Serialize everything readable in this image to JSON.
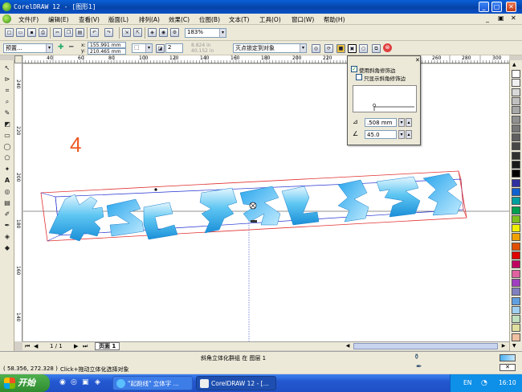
{
  "window": {
    "title": "CorelDRAW 12 - [图形1]"
  },
  "menu": {
    "items": [
      "文件(F)",
      "编辑(E)",
      "查看(V)",
      "版面(L)",
      "排列(A)",
      "效果(C)",
      "位图(B)",
      "文本(T)",
      "工具(O)",
      "窗口(W)",
      "帮助(H)"
    ]
  },
  "standard_toolbar": {
    "zoom": "183%"
  },
  "property_bar": {
    "preset": "预置...",
    "x": "155.991 mm",
    "y": "210.465 mm",
    "depth": "2",
    "vp_x": "8.824 in",
    "vp_y": "40.152 in",
    "vp_lock": "灭点锁定到对象"
  },
  "bevel_panel": {
    "use_bevel_label": "使用斜角修饰边",
    "use_bevel_checked": true,
    "show_bevel_only_label": "只显示斜角修饰边",
    "show_bevel_only_checked": false,
    "depth_value": ".508",
    "depth_unit": "mm",
    "angle_value": "45.0"
  },
  "ruler": {
    "h_ticks": [
      "40",
      "60",
      "80",
      "100",
      "120",
      "140",
      "160",
      "180",
      "200",
      "220",
      "240",
      "260",
      "280",
      "300"
    ],
    "v_ticks": [
      "240",
      "220",
      "200",
      "180",
      "160",
      "140"
    ]
  },
  "canvas": {
    "step_number": "4",
    "extrude_text": "建长 跑线 乱线"
  },
  "page_nav": {
    "counter": "1 / 1",
    "tab": "页面 1"
  },
  "status": {
    "object_info": "斜角立体化群组 在 图层 1",
    "coords": "( 58.356, 272.328 )",
    "hint": "Click+拖动立体化选择对象"
  },
  "taskbar": {
    "start": "开始",
    "tasks": [
      "\"起跑线\" 立体字 ...",
      "CorelDRAW 12 - [..."
    ],
    "lang": "EN",
    "clock": "16:10"
  },
  "palette": [
    "#ffffff",
    "#f0f0f0",
    "#d8d8d8",
    "#c0c0c0",
    "#a8a8a8",
    "#909090",
    "#787878",
    "#606060",
    "#484848",
    "#303030",
    "#181818",
    "#000000",
    "#3030a0",
    "#1060d0",
    "#00a0a0",
    "#00a050",
    "#80c020",
    "#f0f000",
    "#f0a000",
    "#e05000",
    "#e00000",
    "#c00060",
    "#e060a0",
    "#a040c0",
    "#8080c0",
    "#60a0e0",
    "#a0d0f0",
    "#c0e0c0",
    "#e0e0a0",
    "#f0c0a0"
  ],
  "colors": {
    "accent_orange": "#ee5a24",
    "extrude_blue": "#23a6e3",
    "bbox_red": "#e03030",
    "bbox_blue": "#2030d0"
  }
}
